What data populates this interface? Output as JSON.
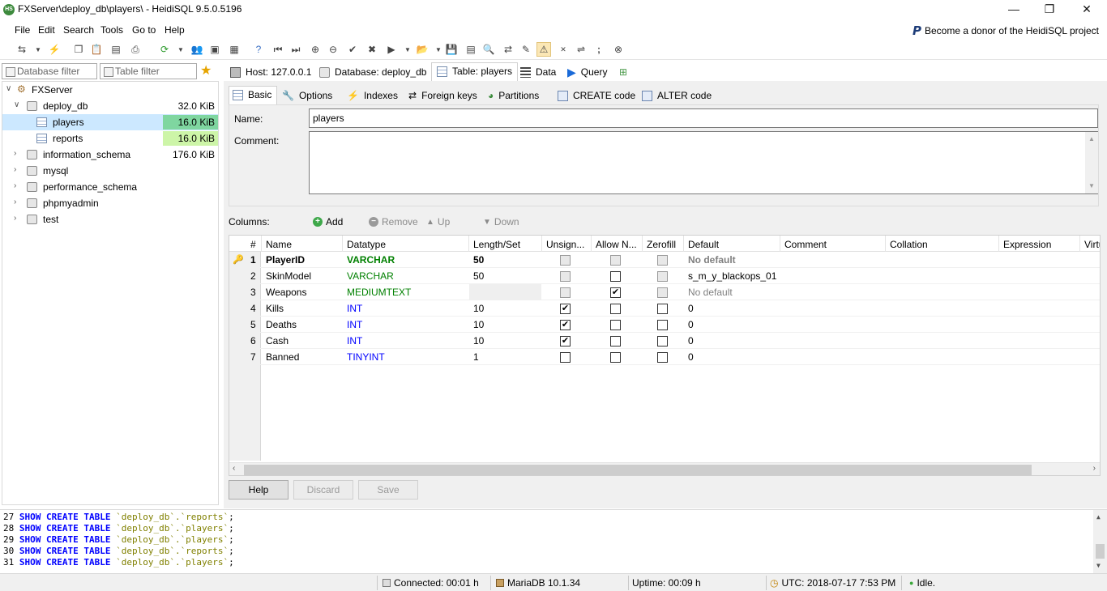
{
  "window": {
    "title": "FXServer\\deploy_db\\players\\ - HeidiSQL 9.5.0.5196",
    "app_icon_text": "HS",
    "minimize": "—",
    "maximize": "❐",
    "close": "✕"
  },
  "menu": {
    "items": [
      "File",
      "Edit",
      "Search",
      "Tools",
      "Go to",
      "Help"
    ],
    "donor_text": "Become a donor of the HeidiSQL project"
  },
  "filters": {
    "database_placeholder": "Database filter",
    "table_placeholder": "Table filter"
  },
  "tree": {
    "root": "FXServer",
    "databases": [
      {
        "name": "deploy_db",
        "size": "32.0 KiB",
        "expanded": true
      },
      {
        "name": "information_schema",
        "size": "176.0 KiB"
      },
      {
        "name": "mysql",
        "size": ""
      },
      {
        "name": "performance_schema",
        "size": ""
      },
      {
        "name": "phpmyadmin",
        "size": ""
      },
      {
        "name": "test",
        "size": ""
      }
    ],
    "tables": [
      {
        "name": "players",
        "size": "16.0 KiB",
        "selected": true
      },
      {
        "name": "reports",
        "size": "16.0 KiB"
      }
    ]
  },
  "main_tabs": [
    {
      "label": "Host: 127.0.0.1",
      "icon": "host-icon"
    },
    {
      "label": "Database: deploy_db",
      "icon": "database-icon"
    },
    {
      "label": "Table: players",
      "icon": "table-icon",
      "active": true
    },
    {
      "label": "Data",
      "icon": "data-icon"
    },
    {
      "label": "Query",
      "icon": "query-icon"
    }
  ],
  "sub_tabs": [
    {
      "label": "Basic",
      "icon": "basic-icon",
      "active": true
    },
    {
      "label": "Options",
      "icon": "options-icon"
    },
    {
      "label": "Indexes",
      "icon": "indexes-icon"
    },
    {
      "label": "Foreign keys",
      "icon": "foreign-keys-icon"
    },
    {
      "label": "Partitions",
      "icon": "partitions-icon"
    },
    {
      "label": "CREATE code",
      "icon": "create-code-icon"
    },
    {
      "label": "ALTER code",
      "icon": "alter-code-icon"
    }
  ],
  "basic": {
    "name_label": "Name:",
    "name_value": "players",
    "comment_label": "Comment:",
    "comment_value": ""
  },
  "columns_bar": {
    "label": "Columns:",
    "add": "Add",
    "remove": "Remove",
    "up": "Up",
    "down": "Down"
  },
  "grid": {
    "headers": [
      "#",
      "Name",
      "Datatype",
      "Length/Set",
      "Unsign...",
      "Allow N...",
      "Zerofill",
      "Default",
      "Comment",
      "Collation",
      "Expression",
      "Virtu"
    ],
    "rows": [
      {
        "num": "1",
        "name": "PlayerID",
        "type": "VARCHAR",
        "length": "50",
        "unsigned": "disabled",
        "allow_null": "disabled",
        "zerofill": "disabled",
        "default": "No default",
        "key": true
      },
      {
        "num": "2",
        "name": "SkinModel",
        "type": "VARCHAR",
        "length": "50",
        "unsigned": "disabled",
        "allow_null": "off",
        "zerofill": "disabled",
        "default": "s_m_y_blackops_01"
      },
      {
        "num": "3",
        "name": "Weapons",
        "type": "MEDIUMTEXT",
        "length": "",
        "unsigned": "disabled",
        "allow_null": "on",
        "zerofill": "disabled",
        "default": "No default"
      },
      {
        "num": "4",
        "name": "Kills",
        "type": "INT",
        "length": "10",
        "unsigned": "on",
        "allow_null": "off",
        "zerofill": "off",
        "default": "0"
      },
      {
        "num": "5",
        "name": "Deaths",
        "type": "INT",
        "length": "10",
        "unsigned": "on",
        "allow_null": "off",
        "zerofill": "off",
        "default": "0"
      },
      {
        "num": "6",
        "name": "Cash",
        "type": "INT",
        "length": "10",
        "unsigned": "on",
        "allow_null": "off",
        "zerofill": "off",
        "default": "0"
      },
      {
        "num": "7",
        "name": "Banned",
        "type": "TINYINT",
        "length": "1",
        "unsigned": "off",
        "allow_null": "off",
        "zerofill": "off",
        "default": "0"
      }
    ]
  },
  "buttons": {
    "help": "Help",
    "discard": "Discard",
    "save": "Save"
  },
  "sql_log": [
    {
      "num": "27",
      "kw": "SHOW CREATE TABLE",
      "obj": "`deploy_db`.`reports`",
      "end": ";"
    },
    {
      "num": "28",
      "kw": "SHOW CREATE TABLE",
      "obj": "`deploy_db`.`players`",
      "end": ";"
    },
    {
      "num": "29",
      "kw": "SHOW CREATE TABLE",
      "obj": "`deploy_db`.`players`",
      "end": ";"
    },
    {
      "num": "30",
      "kw": "SHOW CREATE TABLE",
      "obj": "`deploy_db`.`reports`",
      "end": ";"
    },
    {
      "num": "31",
      "kw": "SHOW CREATE TABLE",
      "obj": "`deploy_db`.`players`",
      "end": ";"
    }
  ],
  "status": {
    "connected": "Connected: 00:01 h",
    "server": "MariaDB 10.1.34",
    "uptime": "Uptime: 00:09 h",
    "utc": "UTC: 2018-07-17 7:53 PM",
    "state": "Idle."
  },
  "colors": {
    "selection": "#cce8ff",
    "size_bar_selected": "#7fd6a0",
    "size_bar": "#cdf5a8",
    "keyword": "#0000ff",
    "datatype_varchar": "#008000",
    "datatype_int": "#0000ff"
  }
}
